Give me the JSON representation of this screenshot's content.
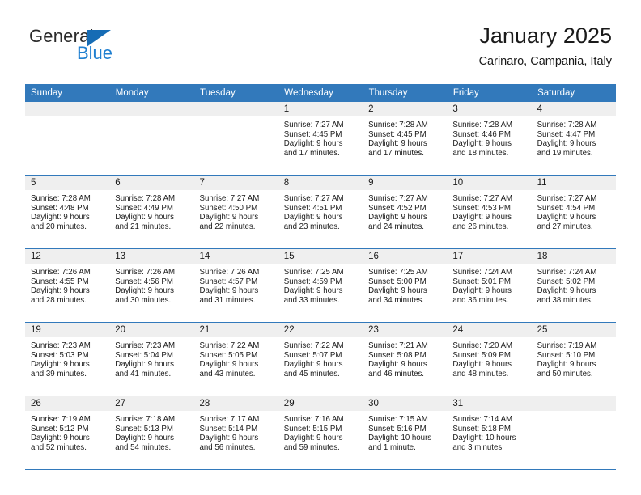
{
  "brand": {
    "name_top": "General",
    "name_bottom": "Blue",
    "triangle_icon": "triangle-icon",
    "color_dark": "#2b2b2b",
    "color_blue": "#1f7fd0"
  },
  "header": {
    "month_title": "January 2025",
    "location": "Carinaro, Campania, Italy"
  },
  "theme": {
    "header_blue": "#3279bb",
    "daynum_band": "#efefef",
    "cell_background": "#ffffff",
    "text": "#1a1a1a"
  },
  "calendar": {
    "weekday_headers": [
      "Sunday",
      "Monday",
      "Tuesday",
      "Wednesday",
      "Thursday",
      "Friday",
      "Saturday"
    ],
    "weeks": [
      [
        {
          "day": "",
          "sunrise": "",
          "sunset": "",
          "daylight_line1": "",
          "daylight_line2": ""
        },
        {
          "day": "",
          "sunrise": "",
          "sunset": "",
          "daylight_line1": "",
          "daylight_line2": ""
        },
        {
          "day": "",
          "sunrise": "",
          "sunset": "",
          "daylight_line1": "",
          "daylight_line2": ""
        },
        {
          "day": "1",
          "sunrise": "Sunrise: 7:27 AM",
          "sunset": "Sunset: 4:45 PM",
          "daylight_line1": "Daylight: 9 hours",
          "daylight_line2": "and 17 minutes."
        },
        {
          "day": "2",
          "sunrise": "Sunrise: 7:28 AM",
          "sunset": "Sunset: 4:45 PM",
          "daylight_line1": "Daylight: 9 hours",
          "daylight_line2": "and 17 minutes."
        },
        {
          "day": "3",
          "sunrise": "Sunrise: 7:28 AM",
          "sunset": "Sunset: 4:46 PM",
          "daylight_line1": "Daylight: 9 hours",
          "daylight_line2": "and 18 minutes."
        },
        {
          "day": "4",
          "sunrise": "Sunrise: 7:28 AM",
          "sunset": "Sunset: 4:47 PM",
          "daylight_line1": "Daylight: 9 hours",
          "daylight_line2": "and 19 minutes."
        }
      ],
      [
        {
          "day": "5",
          "sunrise": "Sunrise: 7:28 AM",
          "sunset": "Sunset: 4:48 PM",
          "daylight_line1": "Daylight: 9 hours",
          "daylight_line2": "and 20 minutes."
        },
        {
          "day": "6",
          "sunrise": "Sunrise: 7:28 AM",
          "sunset": "Sunset: 4:49 PM",
          "daylight_line1": "Daylight: 9 hours",
          "daylight_line2": "and 21 minutes."
        },
        {
          "day": "7",
          "sunrise": "Sunrise: 7:27 AM",
          "sunset": "Sunset: 4:50 PM",
          "daylight_line1": "Daylight: 9 hours",
          "daylight_line2": "and 22 minutes."
        },
        {
          "day": "8",
          "sunrise": "Sunrise: 7:27 AM",
          "sunset": "Sunset: 4:51 PM",
          "daylight_line1": "Daylight: 9 hours",
          "daylight_line2": "and 23 minutes."
        },
        {
          "day": "9",
          "sunrise": "Sunrise: 7:27 AM",
          "sunset": "Sunset: 4:52 PM",
          "daylight_line1": "Daylight: 9 hours",
          "daylight_line2": "and 24 minutes."
        },
        {
          "day": "10",
          "sunrise": "Sunrise: 7:27 AM",
          "sunset": "Sunset: 4:53 PM",
          "daylight_line1": "Daylight: 9 hours",
          "daylight_line2": "and 26 minutes."
        },
        {
          "day": "11",
          "sunrise": "Sunrise: 7:27 AM",
          "sunset": "Sunset: 4:54 PM",
          "daylight_line1": "Daylight: 9 hours",
          "daylight_line2": "and 27 minutes."
        }
      ],
      [
        {
          "day": "12",
          "sunrise": "Sunrise: 7:26 AM",
          "sunset": "Sunset: 4:55 PM",
          "daylight_line1": "Daylight: 9 hours",
          "daylight_line2": "and 28 minutes."
        },
        {
          "day": "13",
          "sunrise": "Sunrise: 7:26 AM",
          "sunset": "Sunset: 4:56 PM",
          "daylight_line1": "Daylight: 9 hours",
          "daylight_line2": "and 30 minutes."
        },
        {
          "day": "14",
          "sunrise": "Sunrise: 7:26 AM",
          "sunset": "Sunset: 4:57 PM",
          "daylight_line1": "Daylight: 9 hours",
          "daylight_line2": "and 31 minutes."
        },
        {
          "day": "15",
          "sunrise": "Sunrise: 7:25 AM",
          "sunset": "Sunset: 4:59 PM",
          "daylight_line1": "Daylight: 9 hours",
          "daylight_line2": "and 33 minutes."
        },
        {
          "day": "16",
          "sunrise": "Sunrise: 7:25 AM",
          "sunset": "Sunset: 5:00 PM",
          "daylight_line1": "Daylight: 9 hours",
          "daylight_line2": "and 34 minutes."
        },
        {
          "day": "17",
          "sunrise": "Sunrise: 7:24 AM",
          "sunset": "Sunset: 5:01 PM",
          "daylight_line1": "Daylight: 9 hours",
          "daylight_line2": "and 36 minutes."
        },
        {
          "day": "18",
          "sunrise": "Sunrise: 7:24 AM",
          "sunset": "Sunset: 5:02 PM",
          "daylight_line1": "Daylight: 9 hours",
          "daylight_line2": "and 38 minutes."
        }
      ],
      [
        {
          "day": "19",
          "sunrise": "Sunrise: 7:23 AM",
          "sunset": "Sunset: 5:03 PM",
          "daylight_line1": "Daylight: 9 hours",
          "daylight_line2": "and 39 minutes."
        },
        {
          "day": "20",
          "sunrise": "Sunrise: 7:23 AM",
          "sunset": "Sunset: 5:04 PM",
          "daylight_line1": "Daylight: 9 hours",
          "daylight_line2": "and 41 minutes."
        },
        {
          "day": "21",
          "sunrise": "Sunrise: 7:22 AM",
          "sunset": "Sunset: 5:05 PM",
          "daylight_line1": "Daylight: 9 hours",
          "daylight_line2": "and 43 minutes."
        },
        {
          "day": "22",
          "sunrise": "Sunrise: 7:22 AM",
          "sunset": "Sunset: 5:07 PM",
          "daylight_line1": "Daylight: 9 hours",
          "daylight_line2": "and 45 minutes."
        },
        {
          "day": "23",
          "sunrise": "Sunrise: 7:21 AM",
          "sunset": "Sunset: 5:08 PM",
          "daylight_line1": "Daylight: 9 hours",
          "daylight_line2": "and 46 minutes."
        },
        {
          "day": "24",
          "sunrise": "Sunrise: 7:20 AM",
          "sunset": "Sunset: 5:09 PM",
          "daylight_line1": "Daylight: 9 hours",
          "daylight_line2": "and 48 minutes."
        },
        {
          "day": "25",
          "sunrise": "Sunrise: 7:19 AM",
          "sunset": "Sunset: 5:10 PM",
          "daylight_line1": "Daylight: 9 hours",
          "daylight_line2": "and 50 minutes."
        }
      ],
      [
        {
          "day": "26",
          "sunrise": "Sunrise: 7:19 AM",
          "sunset": "Sunset: 5:12 PM",
          "daylight_line1": "Daylight: 9 hours",
          "daylight_line2": "and 52 minutes."
        },
        {
          "day": "27",
          "sunrise": "Sunrise: 7:18 AM",
          "sunset": "Sunset: 5:13 PM",
          "daylight_line1": "Daylight: 9 hours",
          "daylight_line2": "and 54 minutes."
        },
        {
          "day": "28",
          "sunrise": "Sunrise: 7:17 AM",
          "sunset": "Sunset: 5:14 PM",
          "daylight_line1": "Daylight: 9 hours",
          "daylight_line2": "and 56 minutes."
        },
        {
          "day": "29",
          "sunrise": "Sunrise: 7:16 AM",
          "sunset": "Sunset: 5:15 PM",
          "daylight_line1": "Daylight: 9 hours",
          "daylight_line2": "and 59 minutes."
        },
        {
          "day": "30",
          "sunrise": "Sunrise: 7:15 AM",
          "sunset": "Sunset: 5:16 PM",
          "daylight_line1": "Daylight: 10 hours",
          "daylight_line2": "and 1 minute."
        },
        {
          "day": "31",
          "sunrise": "Sunrise: 7:14 AM",
          "sunset": "Sunset: 5:18 PM",
          "daylight_line1": "Daylight: 10 hours",
          "daylight_line2": "and 3 minutes."
        },
        {
          "day": "",
          "sunrise": "",
          "sunset": "",
          "daylight_line1": "",
          "daylight_line2": ""
        }
      ]
    ]
  }
}
